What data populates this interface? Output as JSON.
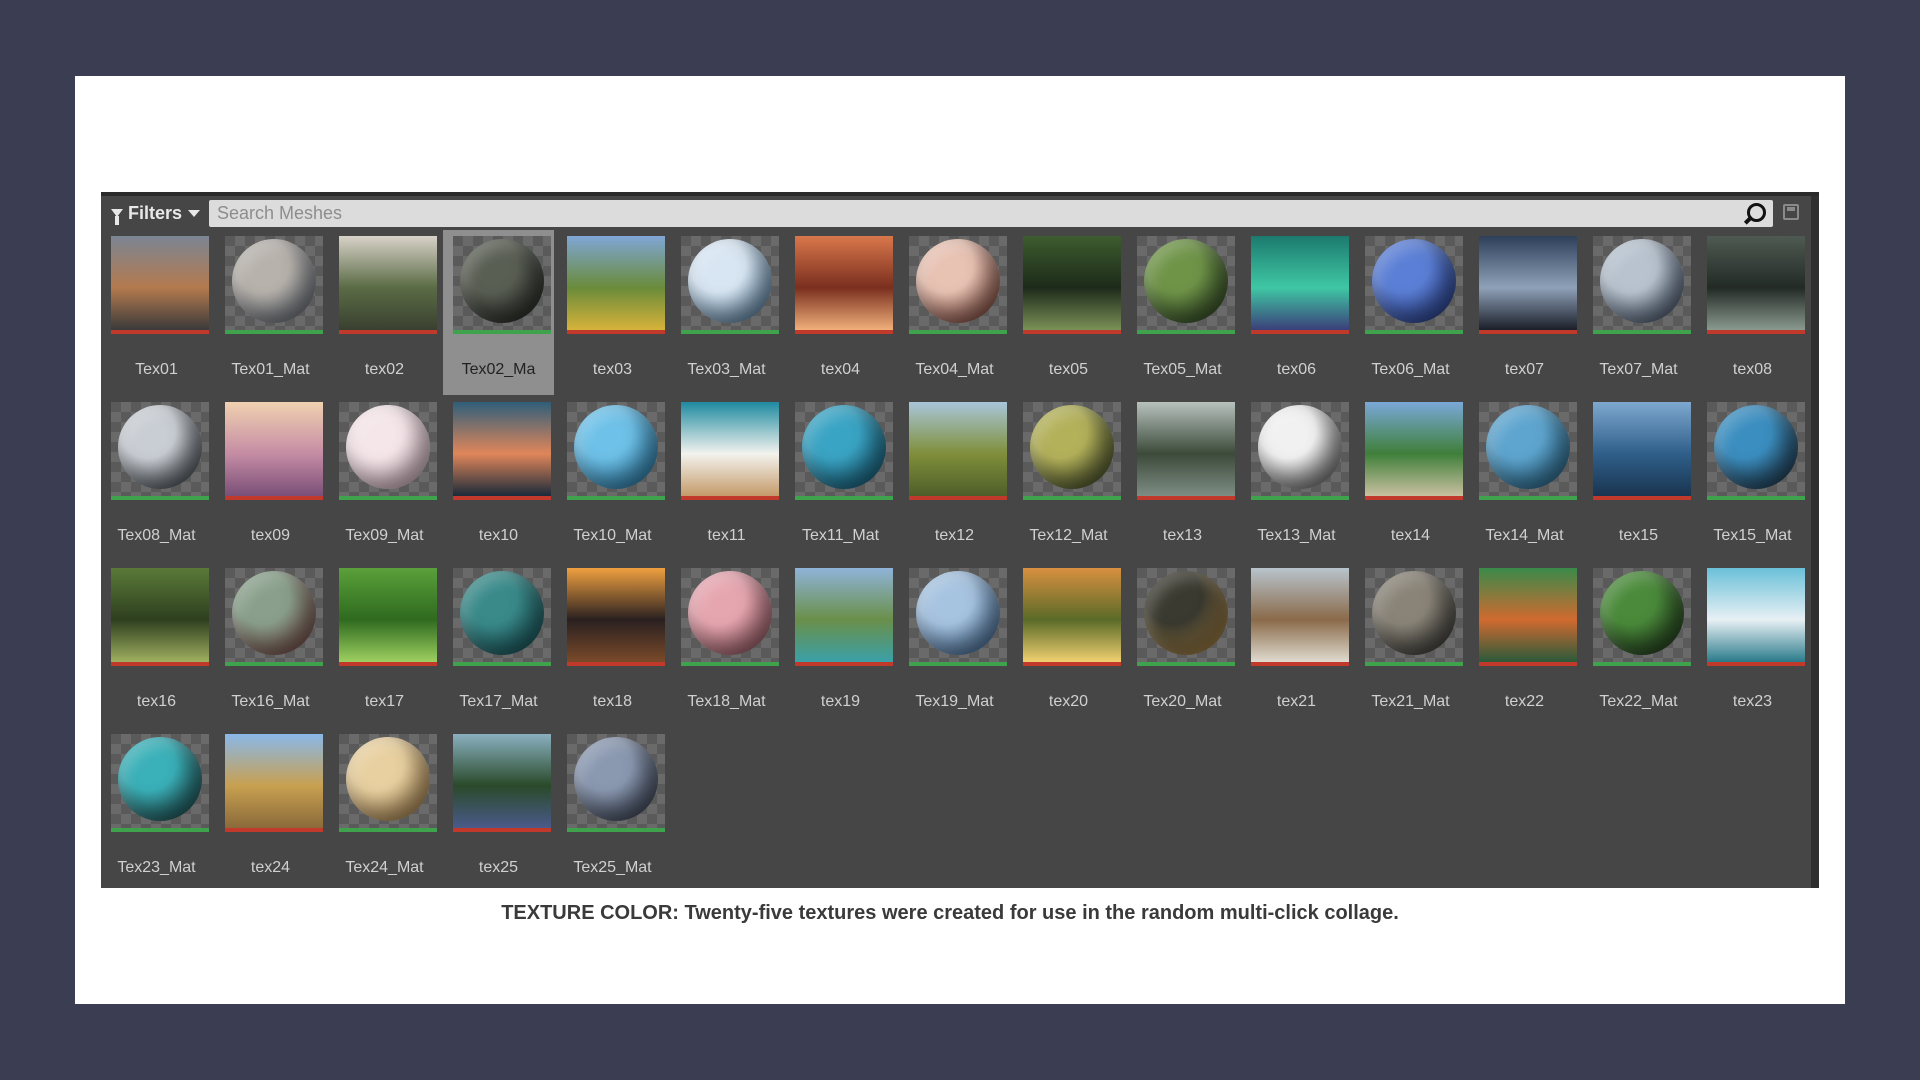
{
  "toolbar": {
    "filters_label": "Filters",
    "search_placeholder": "Search Meshes"
  },
  "caption": "TEXTURE COLOR: Twenty-five textures were created for use in the random multi-click collage.",
  "colors": {
    "texture_bar": "#c0392b",
    "material_bar": "#3fa34d",
    "panel_bg": "#464646",
    "page_bg": "#3b3d52"
  },
  "assets": [
    {
      "label": "Tex01",
      "kind": "texture",
      "colors": [
        "#7b8593",
        "#b47a4e",
        "#3a3a3a"
      ]
    },
    {
      "label": "Tex01_Mat",
      "kind": "material",
      "colors": [
        "#b7b2ac",
        "#5b6575"
      ]
    },
    {
      "label": "tex02",
      "kind": "texture",
      "colors": [
        "#d8d2c8",
        "#5a6b45",
        "#3a4030"
      ]
    },
    {
      "label": "Tex02_Ma",
      "kind": "material",
      "colors": [
        "#5a5f54",
        "#1b1d1a"
      ],
      "selected": true
    },
    {
      "label": "tex03",
      "kind": "texture",
      "colors": [
        "#7fa6d6",
        "#6a8b3a",
        "#d7b33a"
      ]
    },
    {
      "label": "Tex03_Mat",
      "kind": "material",
      "colors": [
        "#d8e6f3",
        "#3b6c93"
      ]
    },
    {
      "label": "tex04",
      "kind": "texture",
      "colors": [
        "#d9774b",
        "#7a2f1f",
        "#f0b07a"
      ]
    },
    {
      "label": "Tex04_Mat",
      "kind": "material",
      "colors": [
        "#e8c2b3",
        "#6a2b1f"
      ]
    },
    {
      "label": "tex05",
      "kind": "texture",
      "colors": [
        "#3d5c2e",
        "#1d2a1a",
        "#7a9156"
      ]
    },
    {
      "label": "Tex05_Mat",
      "kind": "material",
      "colors": [
        "#6f9448",
        "#243a1e"
      ]
    },
    {
      "label": "tex06",
      "kind": "texture",
      "colors": [
        "#1c7a6e",
        "#3fc7a4",
        "#3b3f7a"
      ]
    },
    {
      "label": "Tex06_Mat",
      "kind": "material",
      "colors": [
        "#5b7fd6",
        "#1c2f78"
      ]
    },
    {
      "label": "tex07",
      "kind": "texture",
      "colors": [
        "#2e3f5a",
        "#8fa1b8",
        "#1a1e28"
      ]
    },
    {
      "label": "Tex07_Mat",
      "kind": "material",
      "colors": [
        "#b8c3cf",
        "#2f3f58"
      ]
    },
    {
      "label": "tex08",
      "kind": "texture",
      "colors": [
        "#4e5a52",
        "#232a25",
        "#8a9a90"
      ]
    },
    {
      "label": "Tex08_Mat",
      "kind": "material",
      "colors": [
        "#c9ced4",
        "#2a2f36"
      ]
    },
    {
      "label": "tex09",
      "kind": "texture",
      "colors": [
        "#f0d1b0",
        "#c58ca4",
        "#7a4f78"
      ]
    },
    {
      "label": "Tex09_Mat",
      "kind": "material",
      "colors": [
        "#f5e6ea",
        "#c8a7b6"
      ]
    },
    {
      "label": "tex10",
      "kind": "texture",
      "colors": [
        "#2f5e7a",
        "#e0865a",
        "#1b2a3a"
      ]
    },
    {
      "label": "Tex10_Mat",
      "kind": "material",
      "colors": [
        "#6ec1e8",
        "#1d6f9e"
      ]
    },
    {
      "label": "tex11",
      "kind": "texture",
      "colors": [
        "#1e8aa0",
        "#f3f3ee",
        "#c49a6a"
      ]
    },
    {
      "label": "Tex11_Mat",
      "kind": "material",
      "colors": [
        "#3aa4c4",
        "#0f4f6a"
      ]
    },
    {
      "label": "tex12",
      "kind": "texture",
      "colors": [
        "#a9c6d9",
        "#7f8f3a",
        "#4f5e2a"
      ]
    },
    {
      "label": "Tex12_Mat",
      "kind": "material",
      "colors": [
        "#b3b15a",
        "#2f3a1f"
      ]
    },
    {
      "label": "tex13",
      "kind": "texture",
      "colors": [
        "#b7c2bd",
        "#3c4a3a",
        "#7e8d84"
      ]
    },
    {
      "label": "Tex13_Mat",
      "kind": "material",
      "colors": [
        "#f1f1f1",
        "#4a4a4a"
      ]
    },
    {
      "label": "tex14",
      "kind": "texture",
      "colors": [
        "#7aa8d8",
        "#3f7f3a",
        "#c9c0a0"
      ]
    },
    {
      "label": "Tex14_Mat",
      "kind": "material",
      "colors": [
        "#5ea5cf",
        "#1e5a7a"
      ]
    },
    {
      "label": "tex15",
      "kind": "texture",
      "colors": [
        "#7ea8cf",
        "#2f5f8a",
        "#1a3550"
      ]
    },
    {
      "label": "Tex15_Mat",
      "kind": "material",
      "colors": [
        "#3b8ec0",
        "#1b2633"
      ]
    },
    {
      "label": "tex16",
      "kind": "texture",
      "colors": [
        "#5a7a38",
        "#2e3f1f",
        "#a0b060"
      ]
    },
    {
      "label": "Tex16_Mat",
      "kind": "material",
      "colors": [
        "#8aa08c",
        "#7a3a3a"
      ]
    },
    {
      "label": "tex17",
      "kind": "texture",
      "colors": [
        "#5aa03a",
        "#2f6a1f",
        "#9ed060"
      ]
    },
    {
      "label": "Tex17_Mat",
      "kind": "material",
      "colors": [
        "#3a8a8a",
        "#124a52"
      ]
    },
    {
      "label": "tex18",
      "kind": "texture",
      "colors": [
        "#f0a040",
        "#2a2020",
        "#7a4a2a"
      ]
    },
    {
      "label": "Tex18_Mat",
      "kind": "material",
      "colors": [
        "#e6a6b0",
        "#8a4a55"
      ]
    },
    {
      "label": "tex19",
      "kind": "texture",
      "colors": [
        "#8fb4d8",
        "#6a8f4a",
        "#3aa0a8"
      ]
    },
    {
      "label": "Tex19_Mat",
      "kind": "material",
      "colors": [
        "#a6c3e0",
        "#2f5a88"
      ]
    },
    {
      "label": "tex20",
      "kind": "texture",
      "colors": [
        "#d89040",
        "#5a6a28",
        "#f0d070"
      ]
    },
    {
      "label": "Tex20_Mat",
      "kind": "material",
      "colors": [
        "#3a3a30",
        "#d0a050"
      ]
    },
    {
      "label": "tex21",
      "kind": "texture",
      "colors": [
        "#b8c4cc",
        "#8a6a4a",
        "#e0dcd0"
      ]
    },
    {
      "label": "Tex21_Mat",
      "kind": "material",
      "colors": [
        "#8a8478",
        "#2a2a28"
      ]
    },
    {
      "label": "tex22",
      "kind": "texture",
      "colors": [
        "#3a8a4a",
        "#d06a30",
        "#2a5a3a"
      ]
    },
    {
      "label": "Tex22_Mat",
      "kind": "material",
      "colors": [
        "#4a8a3a",
        "#1a2a18"
      ]
    },
    {
      "label": "tex23",
      "kind": "texture",
      "colors": [
        "#6ac0d8",
        "#e8f0f4",
        "#2a7a8a"
      ]
    },
    {
      "label": "Tex23_Mat",
      "kind": "material",
      "colors": [
        "#3ab0b8",
        "#1a3a3a"
      ]
    },
    {
      "label": "tex24",
      "kind": "texture",
      "colors": [
        "#8ab8e8",
        "#c8a050",
        "#8a6a3a"
      ]
    },
    {
      "label": "Tex24_Mat",
      "kind": "material",
      "colors": [
        "#e8d0a0",
        "#a07840"
      ]
    },
    {
      "label": "tex25",
      "kind": "texture",
      "colors": [
        "#8ab0c0",
        "#2a4a2a",
        "#4a5a8a"
      ]
    },
    {
      "label": "Tex25_Mat",
      "kind": "material",
      "colors": [
        "#8a98b0",
        "#2a3040"
      ]
    }
  ]
}
